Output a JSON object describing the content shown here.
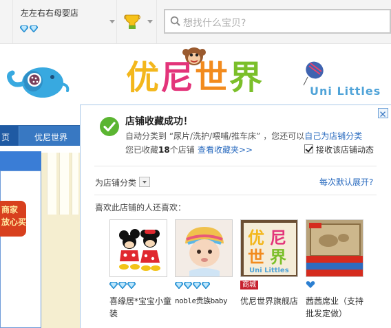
{
  "topbar": {
    "shop_name": "左左右右母婴店",
    "shop_diamonds": 2,
    "search_placeholder": "想找什么宝贝?"
  },
  "banner": {
    "logo_chars": [
      "优",
      "尼",
      "世",
      "界"
    ],
    "logo_colors": [
      "#f3b71c",
      "#e3347a",
      "#f28b1e",
      "#7bbf2a"
    ],
    "logo_sub": "Uni Littles"
  },
  "background_page": {
    "nav_items": [
      "页",
      "优尼世界"
    ],
    "promo_text": "商家\n放心买"
  },
  "popup": {
    "title": "店铺收藏成功！",
    "line1_prefix": "自动分类到 “尿片/洗护/喂哺/推车床” ，您还可以",
    "line1_link": "自己为店铺分类",
    "line2_prefix": "您已收藏",
    "line2_count": "18",
    "line2_suffix": "个店铺",
    "fav_link": "查看收藏夹>>",
    "follow_label": "接收该店铺动态",
    "follow_checked": true,
    "category_label": "为店铺分类",
    "expand_link": "每次默认展开?",
    "recommend_title": "喜欢此店铺的人还喜欢：",
    "recommendations": [
      {
        "name": "喜缘居*宝宝小童装",
        "diamonds": 3,
        "badge": ""
      },
      {
        "name": "noble贵族baby",
        "diamonds": 4,
        "badge": ""
      },
      {
        "name": "优尼世界旗舰店",
        "diamonds": 0,
        "badge": "商城"
      },
      {
        "name": "茜茜席业（支持批发定做）",
        "diamonds": 1,
        "badge": ""
      }
    ]
  },
  "colors": {
    "accent_blue": "#2a6bbf",
    "nav_blue": "#3878c2",
    "success_green": "#5bb531",
    "mall_red": "#c7212f",
    "diamond_blue": "#3aa7e6"
  }
}
